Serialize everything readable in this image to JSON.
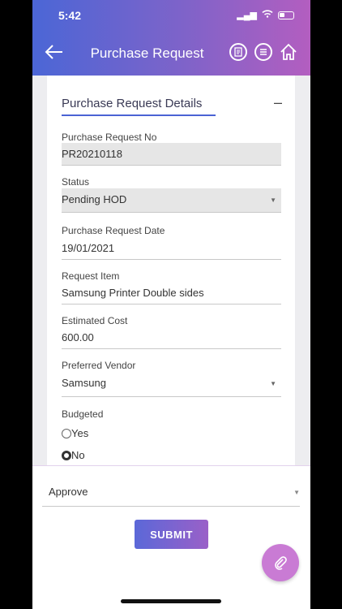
{
  "status_bar": {
    "time": "5:42"
  },
  "header": {
    "title": "Purchase Request",
    "back_icon": "arrow-left-icon",
    "icons": [
      "document-icon",
      "list-icon",
      "home-icon"
    ]
  },
  "section": {
    "title": "Purchase Request Details",
    "collapse_symbol": "–"
  },
  "fields": {
    "request_no": {
      "label": "Purchase Request No",
      "value": "PR20210118"
    },
    "status": {
      "label": "Status",
      "value": "Pending HOD"
    },
    "request_date": {
      "label": "Purchase Request Date",
      "value": "19/01/2021"
    },
    "request_item": {
      "label": "Request Item",
      "value": "Samsung Printer Double sides"
    },
    "estimated_cost": {
      "label": "Estimated Cost",
      "value": "600.00"
    },
    "preferred_vendor": {
      "label": "Preferred Vendor",
      "value": "Samsung"
    },
    "budgeted": {
      "label": "Budgeted",
      "options": [
        "Yes",
        "No"
      ],
      "selected": "No"
    }
  },
  "action": {
    "value": "Approve"
  },
  "submit_label": "SUBMIT",
  "colors": {
    "header_start": "#4b66d6",
    "header_end": "#b35ec0",
    "fab": "#c97bd4"
  }
}
